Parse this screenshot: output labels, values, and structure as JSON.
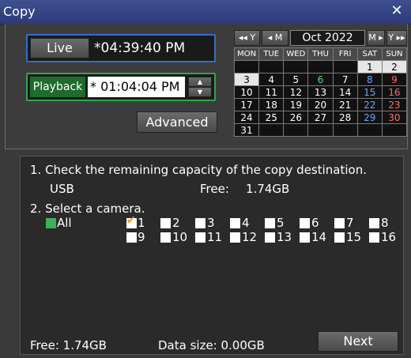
{
  "window": {
    "title": "Copy",
    "close": "✕"
  },
  "live": {
    "button": "Live",
    "time": "*04:39:40 PM"
  },
  "playback": {
    "label": "Playback",
    "time": "* 01:04:04 PM",
    "up": "▲",
    "down": "▼"
  },
  "advanced": {
    "label": "Advanced"
  },
  "calendar": {
    "nav": [
      "◂◂ Y",
      "◂ M",
      "M ▸",
      "Y ▸▸"
    ],
    "month": "Oct 2022",
    "days": [
      "MON",
      "TUE",
      "WED",
      "THU",
      "FRI",
      "SAT",
      "SUN"
    ],
    "weeks": [
      [
        "",
        "",
        "",
        "",
        "",
        "1",
        "2"
      ],
      [
        "3",
        "4",
        "5",
        "6",
        "7",
        "8",
        "9"
      ],
      [
        "10",
        "11",
        "12",
        "13",
        "14",
        "15",
        "16"
      ],
      [
        "17",
        "18",
        "19",
        "20",
        "21",
        "22",
        "23"
      ],
      [
        "24",
        "25",
        "26",
        "27",
        "28",
        "29",
        "30"
      ],
      [
        "31",
        "",
        "",
        "",
        "",
        "",
        ""
      ]
    ]
  },
  "copy": {
    "step1": "1. Check the remaining capacity of the copy destination.",
    "device": "USB",
    "free_label": "Free:",
    "free_value": "1.74GB",
    "step2": "2. Select a camera.",
    "all_label": "All",
    "cameras": [
      "1",
      "2",
      "3",
      "4",
      "5",
      "6",
      "7",
      "8",
      "9",
      "10",
      "11",
      "12",
      "13",
      "14",
      "15",
      "16"
    ],
    "checked_camera": "1"
  },
  "footer": {
    "free": "Free:  1.74GB",
    "data_size": "Data size: 0.00GB",
    "next": "Next"
  }
}
